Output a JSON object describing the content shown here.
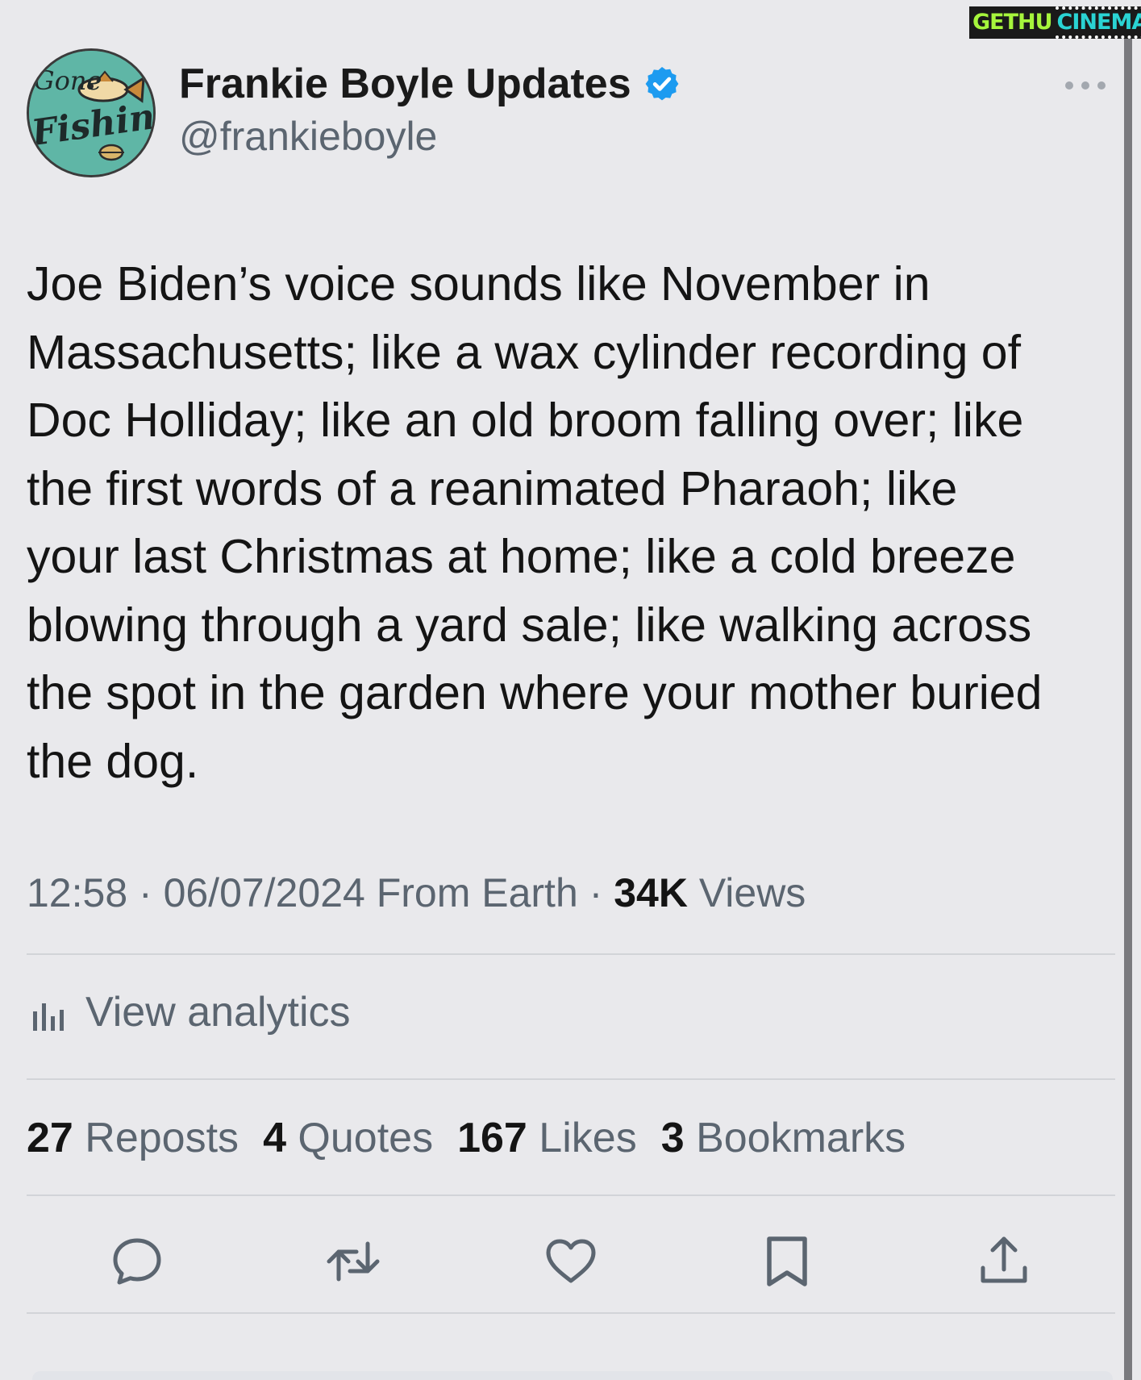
{
  "watermark": {
    "left_text": "GETHU",
    "right_text": "CINEMA"
  },
  "author": {
    "avatar_text_top": "Gone",
    "avatar_text_bottom": "Fishing",
    "display_name": "Frankie Boyle Updates",
    "handle": "@frankieboyle",
    "verified": true
  },
  "tweet": {
    "lines": [
      "Joe Biden’s voice sounds like November in",
      "Massachusetts; like a wax cylinder recording of",
      "Doc Holliday; like an old broom falling over; like",
      "the first words of a reanimated Pharaoh; like",
      "your last Christmas at home; like a cold breeze",
      "blowing through a yard sale; like walking across",
      "the spot in the garden where your mother buried",
      "the dog."
    ]
  },
  "meta": {
    "time": "12:58",
    "separator": " · ",
    "date": "06/07/2024",
    "source": " From Earth",
    "views_count": "34K",
    "views_label": " Views"
  },
  "analytics": {
    "label": "View analytics",
    "icon": "bar-chart-icon"
  },
  "stats": [
    {
      "count": "27",
      "label": " Reposts"
    },
    {
      "count": "4",
      "label": " Quotes"
    },
    {
      "count": "167",
      "label": " Likes"
    },
    {
      "count": "3",
      "label": " Bookmarks"
    }
  ],
  "actions": [
    "reply-icon",
    "repost-icon",
    "like-icon",
    "bookmark-icon",
    "share-icon"
  ],
  "colors": {
    "background": "#e9e9ec",
    "text": "#141414",
    "secondary_text": "#5b6570",
    "verified_blue": "#1d9bf0",
    "divider": "#d2d4d8"
  }
}
